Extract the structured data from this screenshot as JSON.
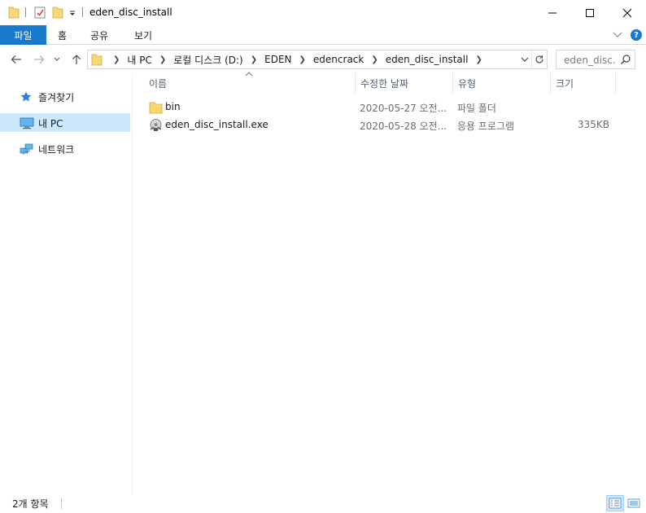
{
  "window": {
    "title": "eden_disc_install",
    "minimize_glyph": "—",
    "maximize_glyph": "☐",
    "close_glyph": "✕"
  },
  "ribbon": {
    "tabs": [
      {
        "label": "파일"
      },
      {
        "label": "홈"
      },
      {
        "label": "공유"
      },
      {
        "label": "보기"
      }
    ]
  },
  "address": {
    "breadcrumbs": [
      "내 PC",
      "로컬 디스크 (D:)",
      "EDEN",
      "edencrack",
      "eden_disc_install"
    ]
  },
  "search": {
    "placeholder": "eden_disc..."
  },
  "navigation": {
    "items": [
      {
        "label": "즐겨찾기",
        "icon": "star-icon"
      },
      {
        "label": "내 PC",
        "icon": "computer-icon",
        "selected": true
      },
      {
        "label": "네트워크",
        "icon": "network-icon"
      }
    ]
  },
  "file_list": {
    "columns": {
      "name": "이름",
      "date": "수정한 날짜",
      "type": "유형",
      "size": "크기"
    },
    "rows": [
      {
        "name": "bin",
        "date": "2020-05-27 오전...",
        "type": "파일 폴더",
        "size": "",
        "icon": "folder-icon"
      },
      {
        "name": "eden_disc_install.exe",
        "date": "2020-05-28 오전...",
        "type": "응용 프로그램",
        "size": "335KB",
        "icon": "installer-exe-icon"
      }
    ]
  },
  "status": {
    "item_count": "2개 항목"
  },
  "colors": {
    "accent": "#1979ca",
    "selection": "#cce8ff",
    "folder": "#f8d775"
  }
}
